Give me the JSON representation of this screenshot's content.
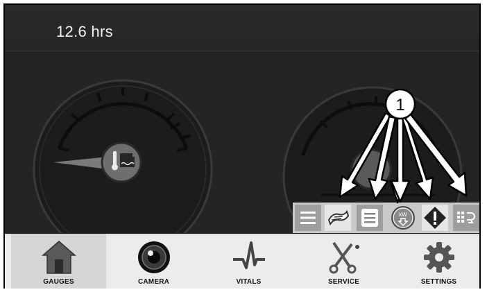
{
  "status": {
    "engine_hours": "12.6 hrs"
  },
  "callout": {
    "number": "1"
  },
  "toolbar": {
    "buttons": [
      {
        "icon": "menu-lines-icon"
      },
      {
        "icon": "map-route-icon"
      },
      {
        "icon": "list-document-icon"
      },
      {
        "icon": "kw-down-icon",
        "text": "kW"
      },
      {
        "icon": "warning-diamond-icon"
      },
      {
        "icon": "engine-flow-icon"
      }
    ]
  },
  "nav": {
    "items": [
      {
        "label": "GAUGES",
        "icon": "home-icon",
        "active": true
      },
      {
        "label": "CAMERA",
        "icon": "camera-lens-icon",
        "active": false
      },
      {
        "label": "VITALS",
        "icon": "pulse-icon",
        "active": false
      },
      {
        "label": "SERVICE",
        "icon": "wrench-screwdriver-icon",
        "active": false
      },
      {
        "label": "SETTINGS",
        "icon": "gear-icon",
        "active": false
      }
    ]
  },
  "colors": {
    "background": "#1f1f1f",
    "topbar": "#2a2a2a",
    "nav": "#ececec",
    "toolbar": "#c9c9c9",
    "toolbar_tile": "#9e9e9e"
  }
}
